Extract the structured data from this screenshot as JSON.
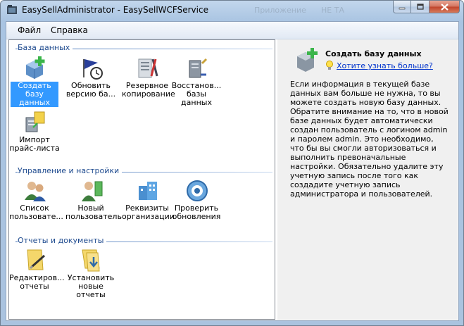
{
  "window": {
    "title": "EasySellAdministrator - EasySellWCFService",
    "ghost_text": [
      "Приложение",
      "НЕ ТА"
    ]
  },
  "menu": {
    "items": [
      "Файл",
      "Справка"
    ]
  },
  "sections": [
    {
      "title": "База данных",
      "tiles": [
        {
          "label": "Создать базу данных",
          "icon": "create-database-icon",
          "selected": true
        },
        {
          "label": "Обновить версию ба...",
          "icon": "update-version-icon"
        },
        {
          "label": "Резервное копирование",
          "icon": "backup-icon"
        },
        {
          "label": "Восстанов... базы данных",
          "icon": "restore-database-icon"
        },
        {
          "label": "Импорт прайс-листа",
          "icon": "import-pricelist-icon"
        }
      ]
    },
    {
      "title": "Управление и настройки",
      "tiles": [
        {
          "label": "Список пользовате...",
          "icon": "users-list-icon"
        },
        {
          "label": "Новый пользователь",
          "icon": "new-user-icon"
        },
        {
          "label": "Реквизиты организации",
          "icon": "organization-details-icon"
        },
        {
          "label": "Проверить обновления",
          "icon": "check-updates-icon"
        }
      ]
    },
    {
      "title": "Отчеты и документы",
      "tiles": [
        {
          "label": "Редактиров... отчеты",
          "icon": "edit-reports-icon"
        },
        {
          "label": "Установить новые отчеты",
          "icon": "install-reports-icon"
        }
      ]
    }
  ],
  "details": {
    "title": "Создать базу данных",
    "link": "Хотите узнать больше?",
    "description": "Если информация в текущей базе данных вам больше не нужна, то вы можете создать новую базу данных. Обратите внимание на то, что в новой базе данных будет автоматически создан пользователь с логином admin и паролем admin. Это необходимо, что бы вы смогли авторизоваться и выполнить превоначальные настройки. Обязательно удалите эту учетную запись после того как создадите учетную запись администратора и пользователей."
  },
  "colors": {
    "selection": "#3399ff",
    "section_title": "#1f4b8f",
    "link": "#0033cc"
  }
}
